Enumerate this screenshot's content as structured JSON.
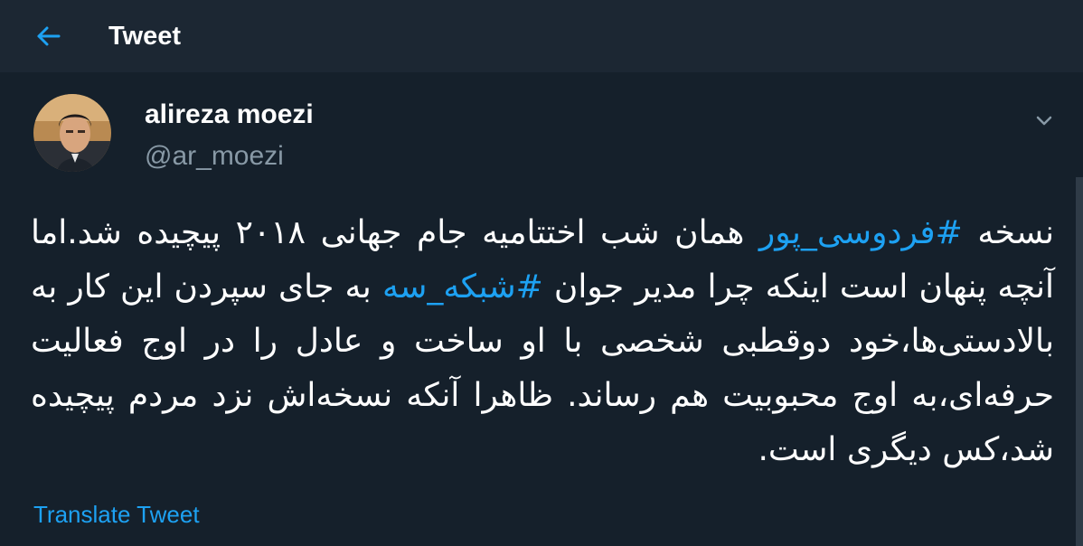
{
  "header": {
    "back_icon": "arrow-left-icon",
    "title": "Tweet"
  },
  "tweet": {
    "author": {
      "display_name": "alireza moezi",
      "handle": "@ar_moezi"
    },
    "menu_icon": "chevron-down-icon",
    "text_parts": {
      "p1": "نسخه ",
      "hashtag1": "#فردوسی_پور",
      "p2": " همان شب اختتامیه جام جهانی ۲۰۱۸ پیچیده شد.اما آنچه پنهان است اینکه چرا مدیر جوان ",
      "hashtag2": "#شبکه_سه",
      "p3": " به جای سپردن این کار به بالادستی‌ها،خود دوقطبی شخصی با او ساخت و عادل را در اوج فعالیت حرفه‌ای،به اوج محبوبیت هم رساند. ظاهرا آنکه نسخه‌اش نزد مردم پیچیده شد،کس دیگری است."
    },
    "translate_label": "Translate Tweet"
  },
  "colors": {
    "background": "#15202b",
    "header_background": "#1c2733",
    "accent": "#1da1f2",
    "secondary_text": "#8899a6"
  }
}
